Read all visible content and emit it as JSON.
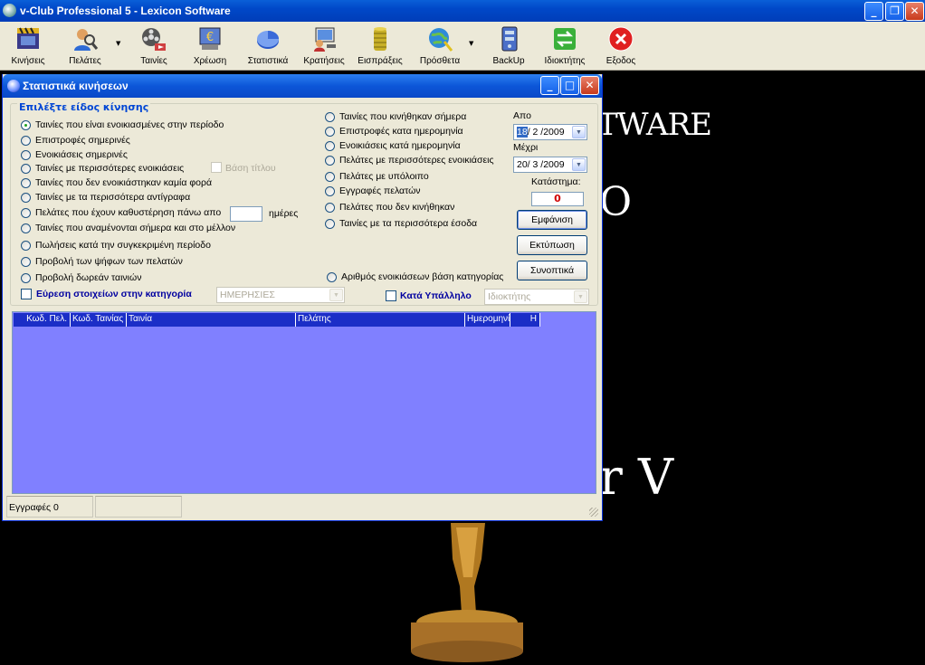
{
  "window": {
    "title": "v-Club Professional 5 - Lexicon Software",
    "min": "_",
    "max": "❐",
    "close": "✕"
  },
  "toolbar": [
    {
      "label": "Κινήσεις",
      "icon": "film-clapper-icon"
    },
    {
      "label": "Πελάτες",
      "icon": "customers-search-icon",
      "dropdown": true
    },
    {
      "label": "Ταινίες",
      "icon": "film-reel-icon"
    },
    {
      "label": "Χρέωση",
      "icon": "charge-euro-icon"
    },
    {
      "label": "Στατιστικά",
      "icon": "pie-chart-icon"
    },
    {
      "label": "Κρατήσεις",
      "icon": "reservations-computer-icon"
    },
    {
      "label": "Εισπράξεις",
      "icon": "coins-stack-icon"
    },
    {
      "label": "Πρόσθετα",
      "icon": "globe-addons-icon",
      "dropdown": true
    },
    {
      "label": "BackUp",
      "icon": "backup-database-icon"
    },
    {
      "label": "Ιδιοκτήτης",
      "icon": "owner-arrows-icon"
    },
    {
      "label": "Εξοδος",
      "icon": "exit-x-icon"
    }
  ],
  "splash": {
    "line1": "TWARE",
    "line2": "O",
    "line3": "r V"
  },
  "dialog": {
    "title": "Στατιστικά κινήσεων",
    "group_label": "Επιλέξτε είδος κίνησης",
    "left_options": [
      "Ταινίες που είναι ενοικιασμένες στην περίοδο",
      "Επιστροφές σημερινές",
      "Ενοικιάσεις σημερινές",
      "Ταινίες με περισσότερες ενοικιάσεις",
      "Ταινίες που δεν ενοικιάστηκαν καμία φορά",
      "Ταινίες με τα περισσότερα αντίγραφα",
      "Πελάτες που έχουν καθυστέρηση πάνω απο",
      "Ταινίες που αναμένονται σήμερα και στο μέλλον",
      "Πωλήσεις κατά την συγκεκριμένη περίοδο",
      "Προβολή των ψήφων των πελατών",
      "Προβολή δωρεάν ταινιών"
    ],
    "selected_option": 0,
    "title_basis_label": "Βάση τίτλου",
    "days_suffix": "ημέρες",
    "right_options": [
      "Ταινίες που κινήθηκαν σήμερα",
      "Επιστροφές κατα ημερομηνία",
      "Ενοικιάσεις κατά ημερομηνία",
      "Πελάτες με περισσότερες ενοικιάσεις",
      "Πελάτες με υπόλοιπο",
      "Εγγραφές πελατών",
      "Πελάτες που δεν κινήθηκαν",
      "Ταινίες με τα περισσότερα έσοδα"
    ],
    "rentals_by_category": "Αριθμός ενοικιάσεων βάση κατηγορίας",
    "from_label": "Απο",
    "from_day": "18",
    "from_rest": "/ 2 /2009",
    "to_label": "Μέχρι",
    "to_value": "20/ 3 /2009",
    "store_label": "Κατάστημα:",
    "store_value": "0",
    "btn_show": "Εμφάνιση",
    "btn_print": "Εκτύπωση",
    "btn_summary": "Συνοπτικά",
    "find_in_category": "Εύρεση στοιχείων στην κατηγορία",
    "category_value": "ΗΜΕΡΗΣΙΕΣ",
    "by_employee": "Κατά Υπάλληλο",
    "employee_value": "Ιδιοκτήτης",
    "columns": [
      "Κωδ. Πελ.",
      "Κωδ. Ταινίας",
      "Ταινία",
      "Πελάτης",
      "Ημερομηνία",
      "Η"
    ],
    "status_records": "Εγγραφές 0",
    "status_2": ""
  }
}
